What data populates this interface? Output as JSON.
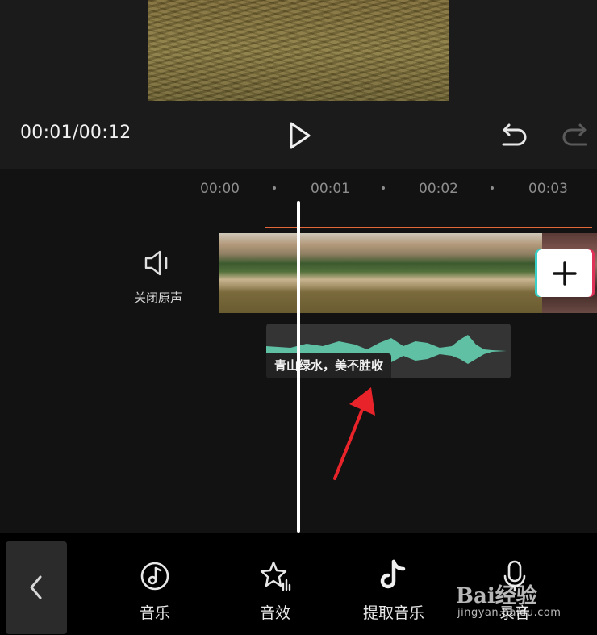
{
  "player": {
    "time": "00:01/00:12"
  },
  "timeline": {
    "ruler": [
      "00:00",
      "00:01",
      "00:02",
      "00:03"
    ],
    "mute_label": "关闭原声",
    "audio_clip_label": "青山绿水，美不胜收"
  },
  "toolbar": {
    "items": [
      {
        "label": "音乐",
        "icon": "music-note-icon"
      },
      {
        "label": "音效",
        "icon": "sound-effect-star-icon"
      },
      {
        "label": "提取音乐",
        "icon": "extract-music-tiktok-icon"
      },
      {
        "label": "录音",
        "icon": "microphone-icon"
      }
    ]
  },
  "watermark": {
    "brand": "Bai经验",
    "domain": "jingyan.baidu.com"
  },
  "colors": {
    "accent_orange": "#e2683c",
    "waveform": "#5fc0a4",
    "annotation_red": "#e8232a"
  }
}
